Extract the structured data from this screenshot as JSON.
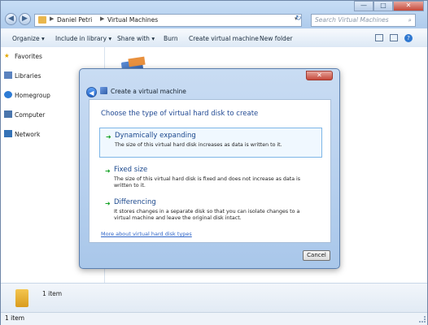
{
  "explorer": {
    "breadcrumb": [
      "Daniel Petri",
      "Virtual Machines"
    ],
    "search_placeholder": "Search Virtual Machines",
    "window_buttons": {
      "minimize": "—",
      "maximize": "□",
      "close": "✕"
    },
    "toolbar": {
      "organize": "Organize ▾",
      "include_in_library": "Include in library ▾",
      "share_with": "Share with ▾",
      "burn": "Burn",
      "create_vm": "Create virtual machine",
      "new_folder": "New folder"
    },
    "sidebar": [
      "Favorites",
      "Libraries",
      "Homegroup",
      "Computer",
      "Network"
    ],
    "details_count": "1 item",
    "status_count": "1 item"
  },
  "dialog": {
    "title": "Create a virtual machine",
    "heading": "Choose the type of virtual hard disk to create",
    "options": [
      {
        "title": "Dynamically expanding",
        "desc": "The size of this virtual hard disk increases as data is written to it."
      },
      {
        "title": "Fixed size",
        "desc": "The size of this virtual hard disk is fixed and does not increase as data is written to it."
      },
      {
        "title": "Differencing",
        "desc": "It stores changes in a separate disk so that you can isolate changes to a virtual machine and leave the original disk intact."
      }
    ],
    "link": "More about virtual hard disk types",
    "cancel": "Cancel"
  },
  "colors": {
    "accent": "#234b94",
    "link": "#2f65c8",
    "arrow_green": "#16a326"
  }
}
